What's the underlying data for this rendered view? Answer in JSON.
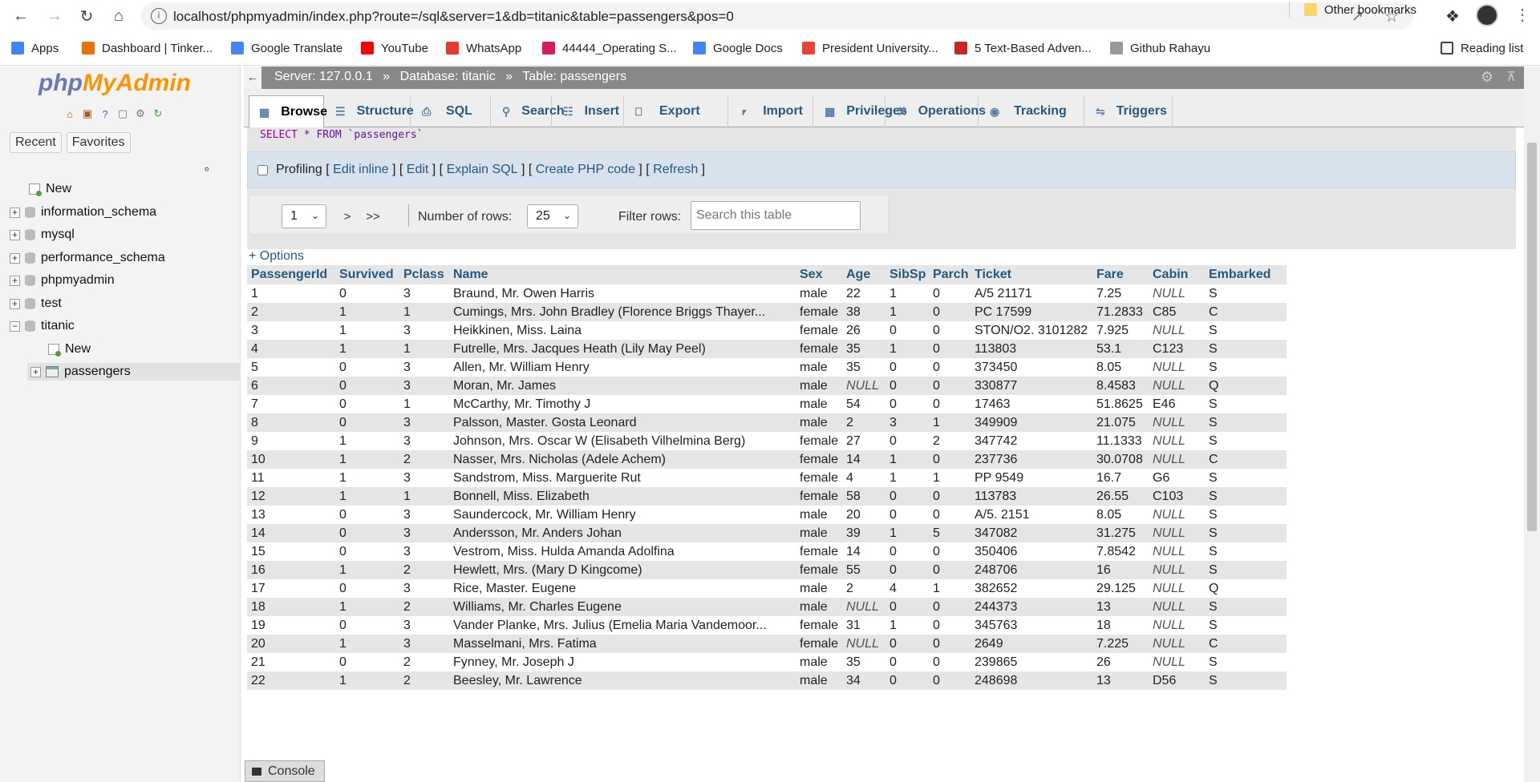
{
  "browser": {
    "url": "localhost/phpmyadmin/index.php?route=/sql&server=1&db=titanic&table=passengers&pos=0",
    "info_icon": "info-icon",
    "bookmarks": [
      {
        "label": "Apps",
        "icon": "apps-grid-icon",
        "color": "#4285f4"
      },
      {
        "label": "Dashboard | Tinker...",
        "icon": "tinkercad-icon",
        "color": "#e8710a"
      },
      {
        "label": "Google Translate",
        "icon": "translate-icon",
        "color": "#4285f4"
      },
      {
        "label": "YouTube",
        "icon": "youtube-icon",
        "color": "#ff0000"
      },
      {
        "label": "WhatsApp",
        "icon": "whatsapp-icon",
        "color": "#e53935"
      },
      {
        "label": "44444_Operating S...",
        "icon": "page-icon",
        "color": "#d81b60"
      },
      {
        "label": "Google Docs",
        "icon": "docs-icon",
        "color": "#4285f4"
      },
      {
        "label": "President University...",
        "icon": "gmail-icon",
        "color": "#ea4335"
      },
      {
        "label": "5 Text-Based Adven...",
        "icon": "page-icon",
        "color": "#c62828"
      },
      {
        "label": "Github Rahayu",
        "icon": "github-icon",
        "color": "#999999"
      }
    ],
    "other_bookmarks": "Other bookmarks",
    "reading_list": "Reading list"
  },
  "sidebar": {
    "logo_php": "php",
    "logo_myadmin": "MyAdmin",
    "tabs": [
      "Recent",
      "Favorites"
    ],
    "tree": [
      {
        "label": "New",
        "type": "new"
      },
      {
        "label": "information_schema",
        "type": "db"
      },
      {
        "label": "mysql",
        "type": "db"
      },
      {
        "label": "performance_schema",
        "type": "db"
      },
      {
        "label": "phpmyadmin",
        "type": "db"
      },
      {
        "label": "test",
        "type": "db"
      },
      {
        "label": "titanic",
        "type": "db-open"
      },
      {
        "label": "New",
        "type": "new-child"
      },
      {
        "label": "passengers",
        "type": "table"
      }
    ]
  },
  "breadcrumb": {
    "server": "Server: 127.0.0.1",
    "database": "Database: titanic",
    "table": "Table: passengers",
    "sep": "»"
  },
  "tabs": [
    {
      "label": "Browse",
      "icon": "browse-icon",
      "active": true
    },
    {
      "label": "Structure",
      "icon": "structure-icon"
    },
    {
      "label": "SQL",
      "icon": "sql-icon"
    },
    {
      "label": "Search",
      "icon": "search-icon"
    },
    {
      "label": "Insert",
      "icon": "insert-icon"
    },
    {
      "label": "Export",
      "icon": "export-icon"
    },
    {
      "label": "Import",
      "icon": "import-icon"
    },
    {
      "label": "Privileges",
      "icon": "privileges-icon"
    },
    {
      "label": "Operations",
      "icon": "operations-icon"
    },
    {
      "label": "Tracking",
      "icon": "tracking-icon"
    },
    {
      "label": "Triggers",
      "icon": "triggers-icon"
    }
  ],
  "sql": {
    "kw_select": "SELECT",
    "rest": " * FROM `passengers`"
  },
  "profiling": {
    "label": "Profiling",
    "links": [
      "Edit inline",
      "Edit",
      "Explain SQL",
      "Create PHP code",
      "Refresh"
    ]
  },
  "pager": {
    "page": "1",
    "next": ">",
    "last": ">>",
    "rows_label": "Number of rows:",
    "rows_value": "25",
    "filter_label": "Filter rows:",
    "filter_placeholder": "Search this table"
  },
  "options_link": "+ Options",
  "console_label": "Console",
  "table": {
    "columns": [
      "PassengerId",
      "Survived",
      "Pclass",
      "Name",
      "Sex",
      "Age",
      "SibSp",
      "Parch",
      "Ticket",
      "Fare",
      "Cabin",
      "Embarked"
    ],
    "rows": [
      [
        "1",
        "0",
        "3",
        "Braund, Mr. Owen Harris",
        "male",
        "22",
        "1",
        "0",
        "A/5 21171",
        "7.25",
        "NULL",
        "S"
      ],
      [
        "2",
        "1",
        "1",
        "Cumings, Mrs. John Bradley (Florence Briggs Thayer...",
        "female",
        "38",
        "1",
        "0",
        "PC 17599",
        "71.2833",
        "C85",
        "C"
      ],
      [
        "3",
        "1",
        "3",
        "Heikkinen, Miss. Laina",
        "female",
        "26",
        "0",
        "0",
        "STON/O2. 3101282",
        "7.925",
        "NULL",
        "S"
      ],
      [
        "4",
        "1",
        "1",
        "Futrelle, Mrs. Jacques Heath (Lily May Peel)",
        "female",
        "35",
        "1",
        "0",
        "113803",
        "53.1",
        "C123",
        "S"
      ],
      [
        "5",
        "0",
        "3",
        "Allen, Mr. William Henry",
        "male",
        "35",
        "0",
        "0",
        "373450",
        "8.05",
        "NULL",
        "S"
      ],
      [
        "6",
        "0",
        "3",
        "Moran, Mr. James",
        "male",
        "NULL",
        "0",
        "0",
        "330877",
        "8.4583",
        "NULL",
        "Q"
      ],
      [
        "7",
        "0",
        "1",
        "McCarthy, Mr. Timothy J",
        "male",
        "54",
        "0",
        "0",
        "17463",
        "51.8625",
        "E46",
        "S"
      ],
      [
        "8",
        "0",
        "3",
        "Palsson, Master. Gosta Leonard",
        "male",
        "2",
        "3",
        "1",
        "349909",
        "21.075",
        "NULL",
        "S"
      ],
      [
        "9",
        "1",
        "3",
        "Johnson, Mrs. Oscar W (Elisabeth Vilhelmina Berg)",
        "female",
        "27",
        "0",
        "2",
        "347742",
        "11.1333",
        "NULL",
        "S"
      ],
      [
        "10",
        "1",
        "2",
        "Nasser, Mrs. Nicholas (Adele Achem)",
        "female",
        "14",
        "1",
        "0",
        "237736",
        "30.0708",
        "NULL",
        "C"
      ],
      [
        "11",
        "1",
        "3",
        "Sandstrom, Miss. Marguerite Rut",
        "female",
        "4",
        "1",
        "1",
        "PP 9549",
        "16.7",
        "G6",
        "S"
      ],
      [
        "12",
        "1",
        "1",
        "Bonnell, Miss. Elizabeth",
        "female",
        "58",
        "0",
        "0",
        "113783",
        "26.55",
        "C103",
        "S"
      ],
      [
        "13",
        "0",
        "3",
        "Saundercock, Mr. William Henry",
        "male",
        "20",
        "0",
        "0",
        "A/5. 2151",
        "8.05",
        "NULL",
        "S"
      ],
      [
        "14",
        "0",
        "3",
        "Andersson, Mr. Anders Johan",
        "male",
        "39",
        "1",
        "5",
        "347082",
        "31.275",
        "NULL",
        "S"
      ],
      [
        "15",
        "0",
        "3",
        "Vestrom, Miss. Hulda Amanda Adolfina",
        "female",
        "14",
        "0",
        "0",
        "350406",
        "7.8542",
        "NULL",
        "S"
      ],
      [
        "16",
        "1",
        "2",
        "Hewlett, Mrs. (Mary D Kingcome)",
        "female",
        "55",
        "0",
        "0",
        "248706",
        "16",
        "NULL",
        "S"
      ],
      [
        "17",
        "0",
        "3",
        "Rice, Master. Eugene",
        "male",
        "2",
        "4",
        "1",
        "382652",
        "29.125",
        "NULL",
        "Q"
      ],
      [
        "18",
        "1",
        "2",
        "Williams, Mr. Charles Eugene",
        "male",
        "NULL",
        "0",
        "0",
        "244373",
        "13",
        "NULL",
        "S"
      ],
      [
        "19",
        "0",
        "3",
        "Vander Planke, Mrs. Julius (Emelia Maria Vandemoor...",
        "female",
        "31",
        "1",
        "0",
        "345763",
        "18",
        "NULL",
        "S"
      ],
      [
        "20",
        "1",
        "3",
        "Masselmani, Mrs. Fatima",
        "female",
        "NULL",
        "0",
        "0",
        "2649",
        "7.225",
        "NULL",
        "C"
      ],
      [
        "21",
        "0",
        "2",
        "Fynney, Mr. Joseph J",
        "male",
        "35",
        "0",
        "0",
        "239865",
        "26",
        "NULL",
        "S"
      ],
      [
        "22",
        "1",
        "2",
        "Beesley, Mr. Lawrence",
        "male",
        "34",
        "0",
        "0",
        "248698",
        "13",
        "D56",
        "S"
      ]
    ]
  }
}
